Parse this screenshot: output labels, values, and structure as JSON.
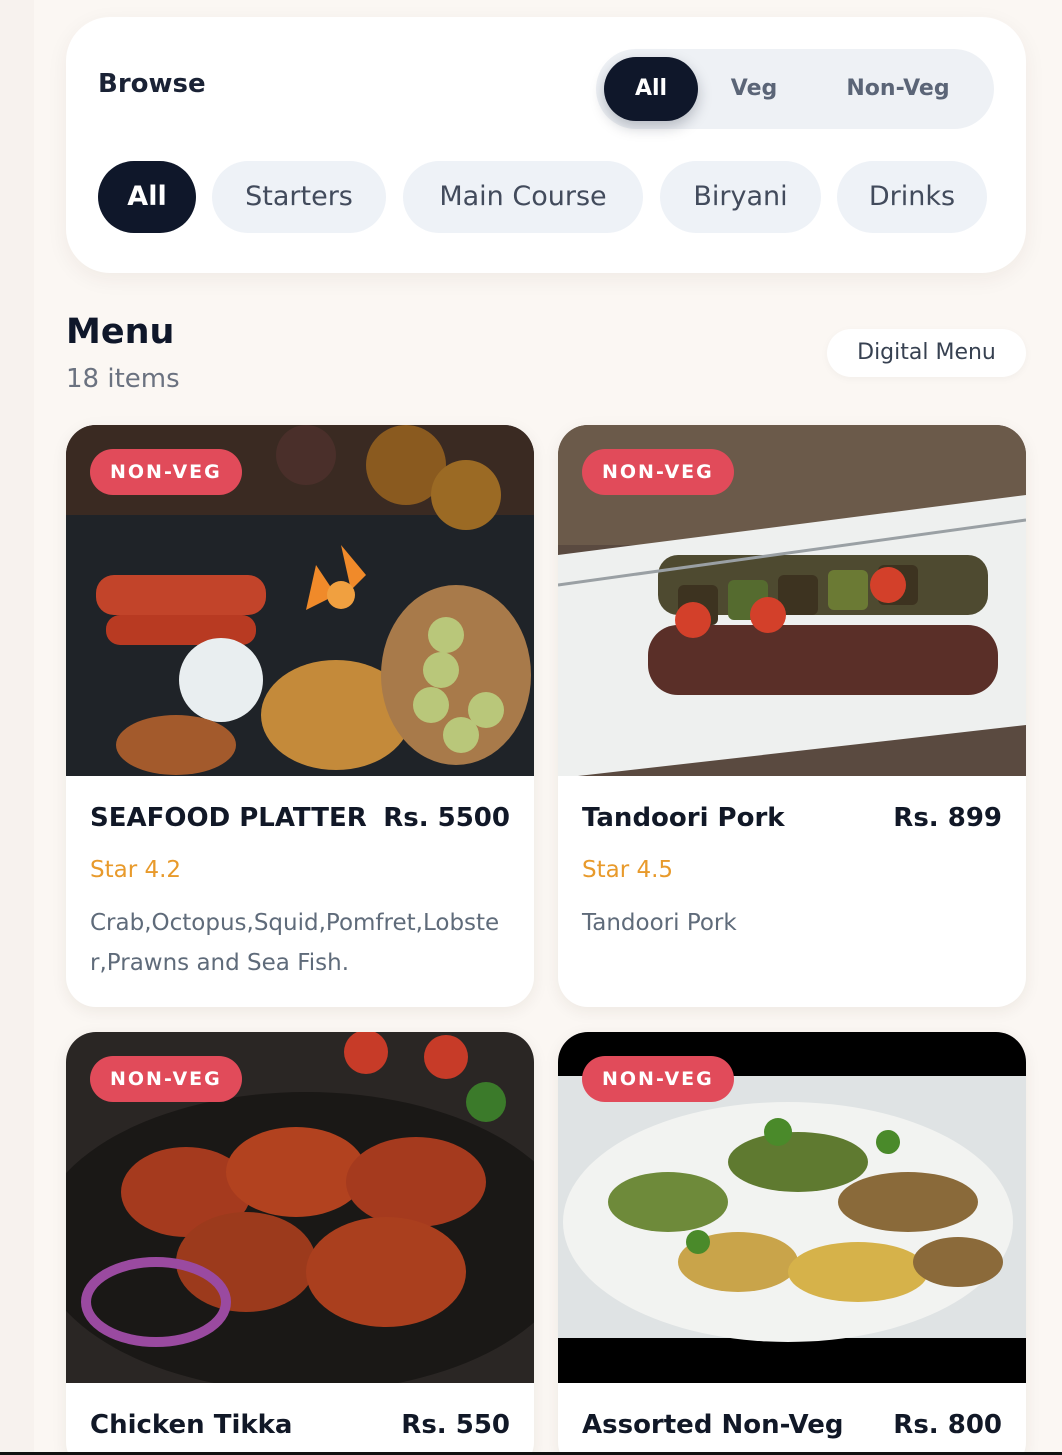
{
  "browse": {
    "title": "Browse",
    "diet_filters": [
      "All",
      "Veg",
      "Non-Veg"
    ],
    "diet_selected": "All",
    "categories": [
      "All",
      "Starters",
      "Main Course",
      "Biryani",
      "Drinks"
    ],
    "category_selected": "All"
  },
  "menu": {
    "title": "Menu",
    "count_label": "18 items",
    "digital_menu_label": "Digital Menu"
  },
  "items": [
    {
      "badge": "NON-VEG",
      "name": "SEAFOOD PLATTER",
      "price": "Rs. 5500",
      "rating": "Star 4.2",
      "description": "Crab,Octopus,Squid,Pomfret,Lobster,Prawns and Sea Fish."
    },
    {
      "badge": "NON-VEG",
      "name": "Tandoori Pork",
      "price": "Rs. 899",
      "rating": "Star 4.5",
      "description": "Tandoori Pork"
    },
    {
      "badge": "NON-VEG",
      "name": "Chicken Tikka",
      "price": "Rs. 550"
    },
    {
      "badge": "NON-VEG",
      "name": "Assorted Non-Veg",
      "price": "Rs. 800"
    }
  ],
  "colors": {
    "accent_dark": "#0f172a",
    "badge_nonveg": "#e14b5a",
    "rating": "#e89a2b"
  }
}
